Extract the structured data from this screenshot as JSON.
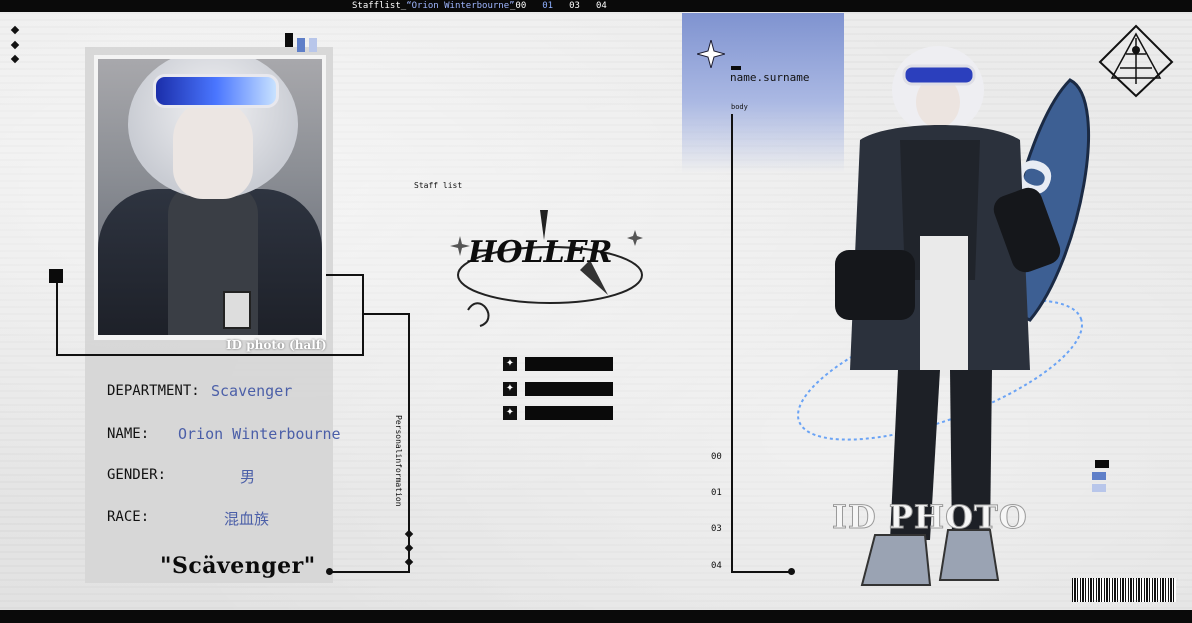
{
  "header": {
    "title_prefix": "Stafflist_",
    "title_name": "“Orion Winterbourne”",
    "indices": [
      "_00",
      "01",
      "03",
      "04"
    ],
    "active_index": "01"
  },
  "profile": {
    "photo_caption": "ID photo (half)",
    "department_label": "DEPARTMENT:",
    "department_value": "Scavenger",
    "name_label": "NAME:",
    "name_value": "Orion Winterbourne",
    "gender_label": "GENDER:",
    "gender_value": "男",
    "race_label": "RACE:",
    "race_value": "混血族",
    "quote": "\"Scävenger\"",
    "vertical_label": "Personalinformation"
  },
  "center": {
    "staff_list_label": "Staff list",
    "logo_text": "HOLLER"
  },
  "right": {
    "name_surname": "name.surname",
    "body_label": "body",
    "indices": [
      "00",
      "01",
      "03",
      "04"
    ],
    "id_photo": "ID PHOTO"
  },
  "colors": {
    "accent_blue": "#4b5fa8",
    "panel_blue": "#7f93d0",
    "black": "#0a0a0a"
  },
  "icons": [
    "sparkle-icon",
    "crest-icon",
    "barcode",
    "star-diamond-icon"
  ]
}
